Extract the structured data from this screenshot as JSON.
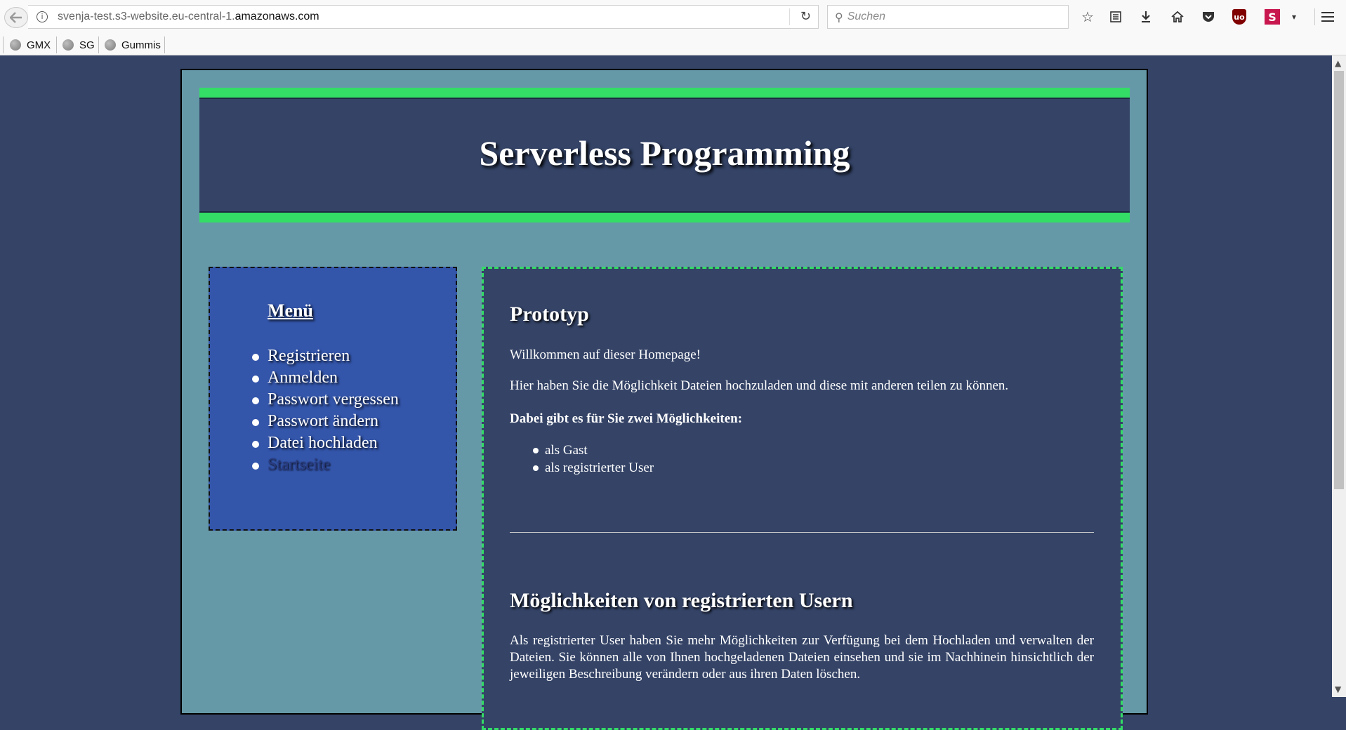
{
  "browser": {
    "url_prefix": "svenja-test.s3-website.eu-central-1.",
    "url_domain": "amazonaws.com",
    "search_placeholder": "Suchen",
    "info_glyph": "i",
    "icons": [
      "back-arrow-icon",
      "info-icon",
      "reload-icon",
      "search-icon",
      "bookmark-star-icon",
      "reader-view-icon",
      "download-icon",
      "home-icon",
      "pocket-icon",
      "ublock-icon",
      "s-extension-icon",
      "dropdown-caret-icon",
      "hamburger-menu-icon"
    ],
    "ublock_label": "uo",
    "s_ext_label": "S"
  },
  "bookmarks": [
    {
      "label": "GMX"
    },
    {
      "label": "SG"
    },
    {
      "label": "Gummis"
    }
  ],
  "header": {
    "title": "Serverless Programming"
  },
  "menu": {
    "title": "Menü",
    "items": [
      {
        "label": "Registrieren"
      },
      {
        "label": "Anmelden"
      },
      {
        "label": "Passwort vergessen"
      },
      {
        "label": "Passwort ändern"
      },
      {
        "label": "Datei hochladen"
      },
      {
        "label": "Startseite",
        "current": true
      }
    ]
  },
  "content": {
    "heading": "Prototyp",
    "welcome": "Willkommen auf dieser Homepage!",
    "intro": "Hier haben Sie die Möglichkeit Dateien hochzuladen und diese mit anderen teilen zu können.",
    "options_title": "Dabei gibt es für Sie zwei Möglichkeiten:",
    "options": [
      {
        "label": "als Gast"
      },
      {
        "label": "als registrierter User"
      }
    ],
    "section2_heading": "Möglichkeiten von registrierten Usern",
    "section2_text": "Als registrierter User haben Sie mehr Möglichkeiten zur Verfügung bei dem Hochladen und verwalten der Dateien. Sie können alle von Ihnen hochgeladenen Dateien einsehen und sie im Nachhinein hinsichtlich der jeweiligen Beschreibung verändern oder aus ihren Daten löschen."
  },
  "colors": {
    "page_background": "#344366",
    "container": "#6699a8",
    "accent_green": "#33dd66",
    "menu_background": "#3355aa",
    "current_menu_item": "#2a3b80"
  }
}
